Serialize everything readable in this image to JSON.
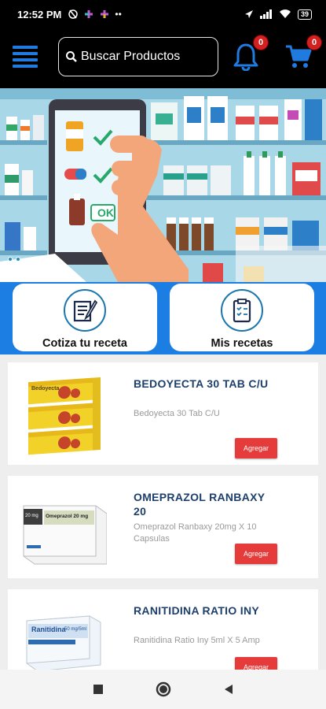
{
  "status_bar": {
    "time": "12:52 PM",
    "battery": "39"
  },
  "header": {
    "search_placeholder": "Buscar Productos",
    "notifications_count": "0",
    "cart_count": "0"
  },
  "quick_actions": [
    {
      "label": "Cotiza tu receta",
      "icon": "prescription-icon"
    },
    {
      "label": "Mis recetas",
      "icon": "clipboard-list-icon"
    }
  ],
  "products": [
    {
      "title": "BEDOYECTA 30 TAB C/U",
      "description": "Bedoyecta 30 Tab C/U",
      "button_label": "Agregar"
    },
    {
      "title": "OMEPRAZOL RANBAXY 20",
      "description": "Omeprazol Ranbaxy 20mg X 10 Capsulas",
      "button_label": "Agregar"
    },
    {
      "title": "RANITIDINA RATIO INY",
      "description": "Ranitidina Ratio Iny 5ml X 5 Amp",
      "button_label": "Agregar"
    }
  ],
  "product_images": {
    "p1_box_text": "Bedoyecta",
    "p2_box_text": "Omeprazol 20 mg",
    "p2_box_badge": "20 mg",
    "p3_box_text": "Ranitidina",
    "p3_box_sub": "50 mg/5ml"
  },
  "banner": {
    "ok_label": "OK"
  },
  "colors": {
    "accent": "#1c7ee3",
    "badge": "#d32020",
    "add_button": "#e53b3b",
    "title": "#1d3f6b"
  }
}
